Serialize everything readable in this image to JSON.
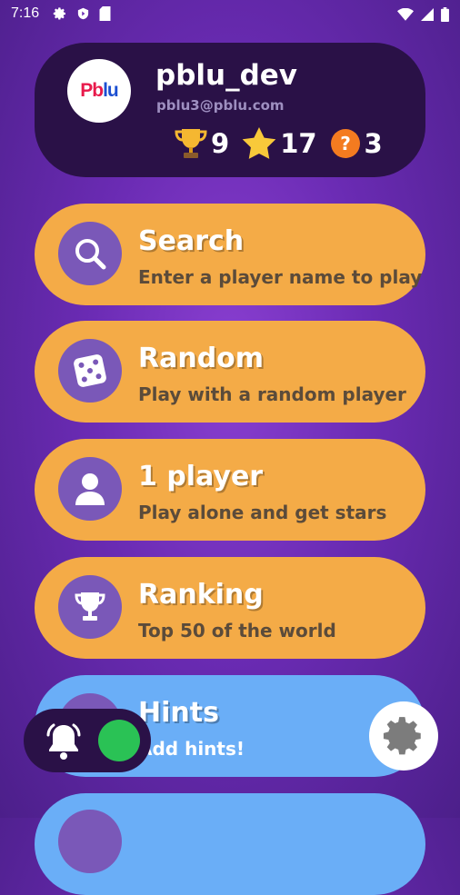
{
  "status_bar": {
    "time": "7:16",
    "icons": [
      "gear-icon",
      "shield-icon",
      "sd-card-icon",
      "wifi-icon",
      "signal-icon",
      "battery-icon"
    ]
  },
  "profile": {
    "avatar_logo_part1": "Pb",
    "avatar_logo_part2": "lu",
    "username": "pblu_dev",
    "email": "pblu3@pblu.com",
    "stats": [
      {
        "icon": "trophy-icon",
        "value": "9"
      },
      {
        "icon": "star-icon",
        "value": "17"
      },
      {
        "icon": "question-icon",
        "value": "3"
      }
    ]
  },
  "menu": [
    {
      "icon": "search-icon",
      "title": "Search",
      "subtitle": "Enter a player name to play"
    },
    {
      "icon": "dice-icon",
      "title": "Random",
      "subtitle": "Play with a random player"
    },
    {
      "icon": "person-icon",
      "title": "1 player",
      "subtitle": "Play alone and get stars"
    },
    {
      "icon": "trophy-icon",
      "title": "Ranking",
      "subtitle": "Top 50 of the world"
    },
    {
      "icon": "hint-icon",
      "title": "Hints",
      "subtitle": "Add hints!"
    }
  ],
  "colors": {
    "background": "#6a2bb3",
    "card_dark": "#2a1147",
    "menu_orange": "#f4ab47",
    "menu_blue": "#6aaef7",
    "icon_circle": "#7a58b8",
    "toggle_on": "#2ac255"
  }
}
